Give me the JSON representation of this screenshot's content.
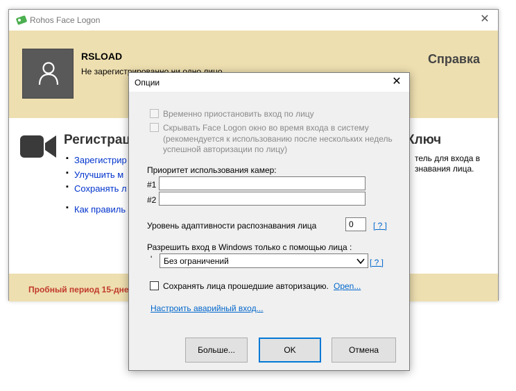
{
  "main_window": {
    "title": "Rohos Face Logon",
    "header": {
      "user_name": "RSLOAD",
      "status": "Не зарегистрированно ни одно лицо",
      "help_label": "Справка"
    },
    "registration": {
      "heading": "Регистрац",
      "links": [
        "Зарегистрир",
        "Улучшить м",
        "Сохранять л",
        "Как правиль"
      ]
    },
    "key": {
      "heading": "Ключ",
      "text_line1": "тель для входа в",
      "text_line2": "знавания лица."
    },
    "footer": {
      "trial_text": "Пробный период 15-днев"
    }
  },
  "dialog": {
    "title": "Опции",
    "suspend_label": "Временно приостановить вход по лицу",
    "hide_label": "Скрывать Face Logon окно во время входа в систему",
    "hide_note_line1": "(рекомендуется к использованию после нескольких недель",
    "hide_note_line2": "успешной авторизации по лицу)",
    "camera_priority_label": "Приоритет использования камер:",
    "camera1_label": "#1",
    "camera1_value": "",
    "camera2_label": "#2",
    "camera2_value": "",
    "adaptivity_label": "Уровень адаптивности распознавания лица",
    "adaptivity_value": "0",
    "help_q": "[ ? ]",
    "face_only_label": "Разрешить вход в Windows только с помощью лица :",
    "face_only_bullet": "'",
    "face_only_selected": "Без ограничений",
    "save_faces_label": "Сохранять лица прошедшие авторизацию.",
    "save_faces_open": "Open...",
    "emergency_link": "Настроить аварийный вход...",
    "buttons": {
      "more": "Больше...",
      "ok": "OK",
      "cancel": "Отмена"
    }
  }
}
